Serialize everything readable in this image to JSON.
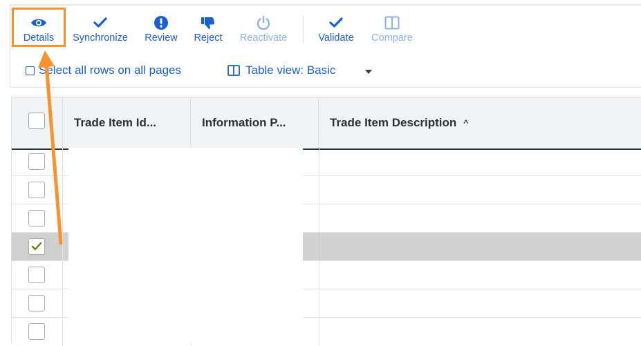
{
  "toolbar": {
    "buttons": [
      {
        "label": "Details",
        "icon": "eye-icon",
        "enabled": true,
        "highlighted": true
      },
      {
        "label": "Synchronize",
        "icon": "checkmark-icon",
        "enabled": true
      },
      {
        "label": "Review",
        "icon": "alert-icon",
        "enabled": true
      },
      {
        "label": "Reject",
        "icon": "thumbs-down-icon",
        "enabled": true
      },
      {
        "label": "Reactivate",
        "icon": "power-icon",
        "enabled": false
      },
      {
        "label": "Validate",
        "icon": "checkmark-icon",
        "enabled": true
      },
      {
        "label": "Compare",
        "icon": "columns-icon",
        "enabled": false
      }
    ],
    "select_all_label": "Select all rows on all pages",
    "table_view_label": "Table view: Basic"
  },
  "table": {
    "columns": [
      "Trade Item Id...",
      "Information P...",
      "Trade Item Description"
    ],
    "sort_indicator": "^",
    "rows": [
      {
        "checked": false
      },
      {
        "checked": false
      },
      {
        "checked": false
      },
      {
        "checked": true
      },
      {
        "checked": false
      },
      {
        "checked": false
      },
      {
        "checked": false
      }
    ]
  },
  "colors": {
    "accent": "#1a5fd0",
    "disabled": "#8fb1e6",
    "highlight": "#f7922f",
    "selected_row": "#d2d2d2"
  }
}
